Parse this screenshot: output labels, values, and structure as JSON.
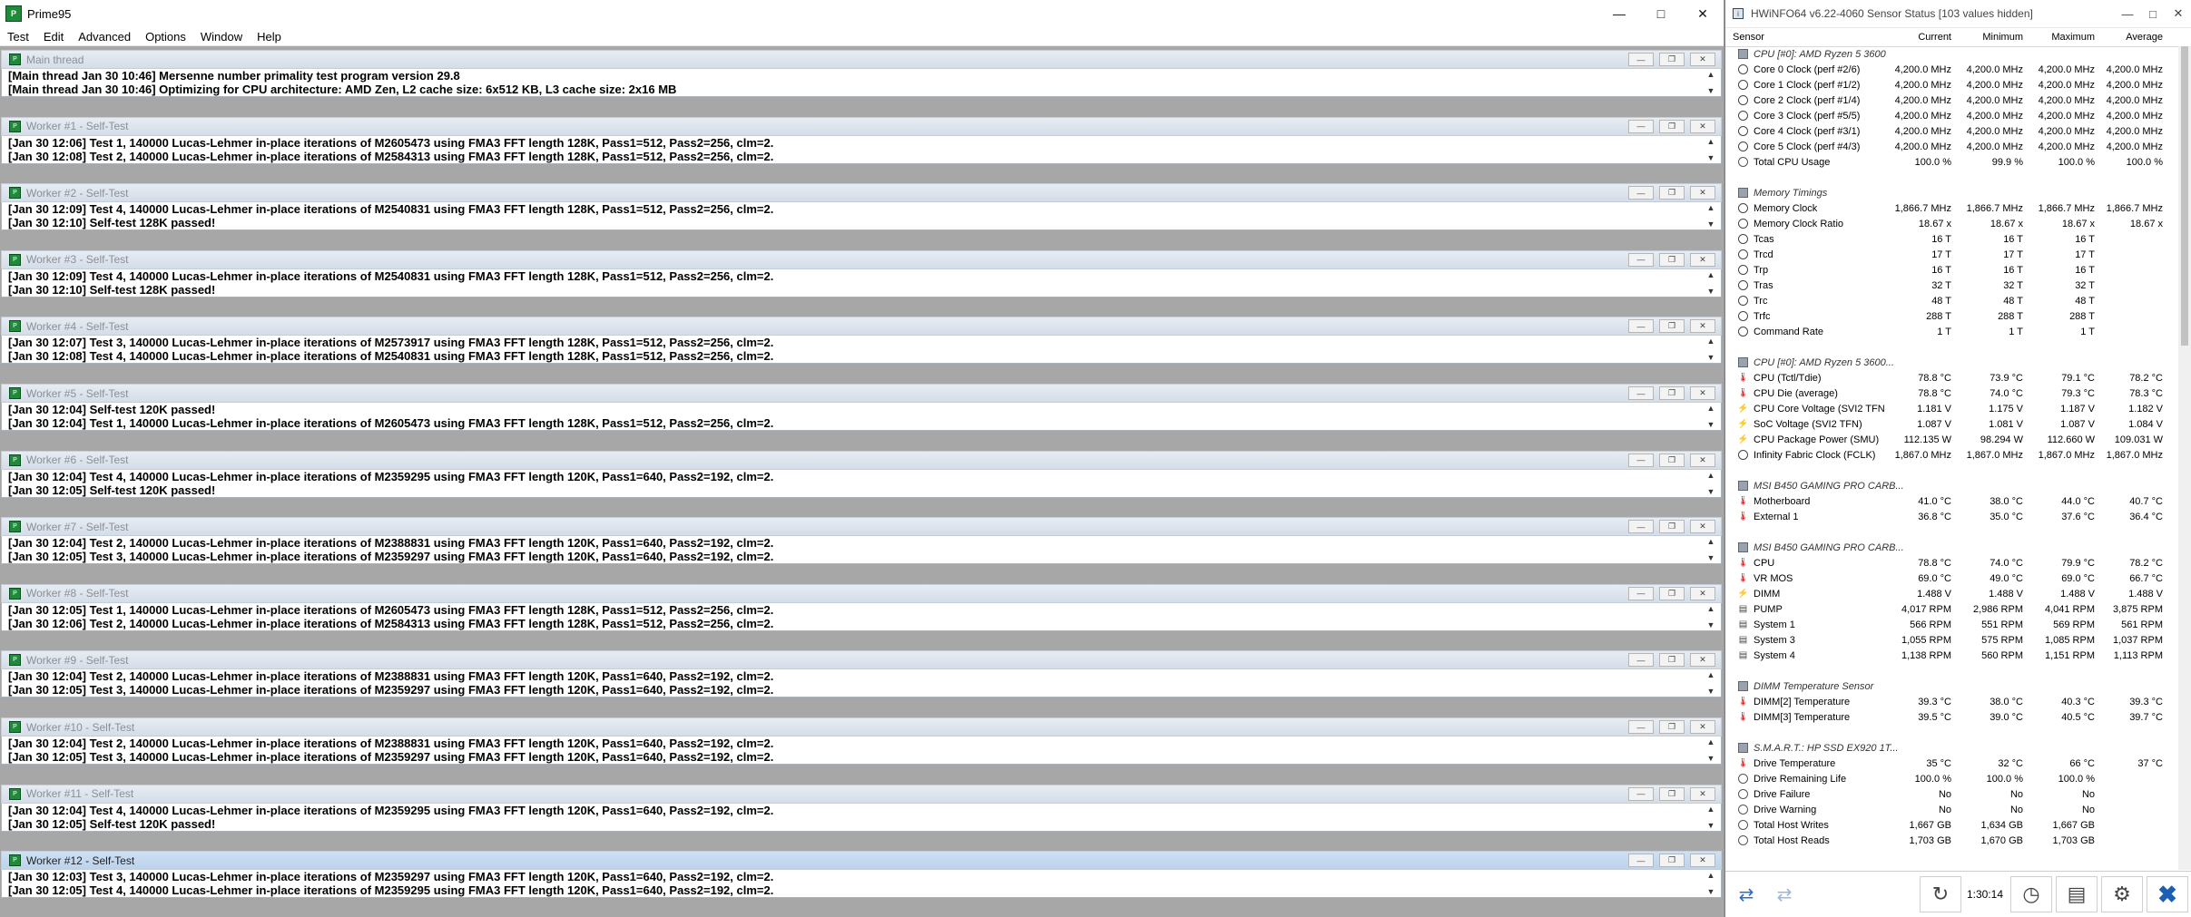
{
  "prime95": {
    "title": "Prime95",
    "menu": [
      "Test",
      "Edit",
      "Advanced",
      "Options",
      "Window",
      "Help"
    ],
    "windows": [
      {
        "title": "Main thread",
        "lines": [
          "[Main thread Jan 30 10:46] Mersenne number primality test program version 29.8",
          "[Main thread Jan 30 10:46] Optimizing for CPU architecture: AMD Zen, L2 cache size: 6x512 KB, L3 cache size: 2x16 MB"
        ]
      },
      {
        "title": "Worker #1 - Self-Test",
        "lines": [
          "[Jan 30 12:06] Test 1, 140000 Lucas-Lehmer in-place iterations of M2605473 using FMA3 FFT length 128K, Pass1=512, Pass2=256, clm=2.",
          "[Jan 30 12:08] Test 2, 140000 Lucas-Lehmer in-place iterations of M2584313 using FMA3 FFT length 128K, Pass1=512, Pass2=256, clm=2."
        ]
      },
      {
        "title": "Worker #2 - Self-Test",
        "lines": [
          "[Jan 30 12:09] Test 4, 140000 Lucas-Lehmer in-place iterations of M2540831 using FMA3 FFT length 128K, Pass1=512, Pass2=256, clm=2.",
          "[Jan 30 12:10] Self-test 128K passed!"
        ]
      },
      {
        "title": "Worker #3 - Self-Test",
        "lines": [
          "[Jan 30 12:09] Test 4, 140000 Lucas-Lehmer in-place iterations of M2540831 using FMA3 FFT length 128K, Pass1=512, Pass2=256, clm=2.",
          "[Jan 30 12:10] Self-test 128K passed!"
        ]
      },
      {
        "title": "Worker #4 - Self-Test",
        "lines": [
          "[Jan 30 12:07] Test 3, 140000 Lucas-Lehmer in-place iterations of M2573917 using FMA3 FFT length 128K, Pass1=512, Pass2=256, clm=2.",
          "[Jan 30 12:08] Test 4, 140000 Lucas-Lehmer in-place iterations of M2540831 using FMA3 FFT length 128K, Pass1=512, Pass2=256, clm=2."
        ]
      },
      {
        "title": "Worker #5 - Self-Test",
        "lines": [
          "[Jan 30 12:04] Self-test 120K passed!",
          "[Jan 30 12:04] Test 1, 140000 Lucas-Lehmer in-place iterations of M2605473 using FMA3 FFT length 128K, Pass1=512, Pass2=256, clm=2."
        ]
      },
      {
        "title": "Worker #6 - Self-Test",
        "lines": [
          "[Jan 30 12:04] Test 4, 140000 Lucas-Lehmer in-place iterations of M2359295 using FMA3 FFT length 120K, Pass1=640, Pass2=192, clm=2.",
          "[Jan 30 12:05] Self-test 120K passed!"
        ]
      },
      {
        "title": "Worker #7 - Self-Test",
        "lines": [
          "[Jan 30 12:04] Test 2, 140000 Lucas-Lehmer in-place iterations of M2388831 using FMA3 FFT length 120K, Pass1=640, Pass2=192, clm=2.",
          "[Jan 30 12:05] Test 3, 140000 Lucas-Lehmer in-place iterations of M2359297 using FMA3 FFT length 120K, Pass1=640, Pass2=192, clm=2."
        ]
      },
      {
        "title": "Worker #8 - Self-Test",
        "lines": [
          "[Jan 30 12:05] Test 1, 140000 Lucas-Lehmer in-place iterations of M2605473 using FMA3 FFT length 128K, Pass1=512, Pass2=256, clm=2.",
          "[Jan 30 12:06] Test 2, 140000 Lucas-Lehmer in-place iterations of M2584313 using FMA3 FFT length 128K, Pass1=512, Pass2=256, clm=2."
        ]
      },
      {
        "title": "Worker #9 - Self-Test",
        "lines": [
          "[Jan 30 12:04] Test 2, 140000 Lucas-Lehmer in-place iterations of M2388831 using FMA3 FFT length 120K, Pass1=640, Pass2=192, clm=2.",
          "[Jan 30 12:05] Test 3, 140000 Lucas-Lehmer in-place iterations of M2359297 using FMA3 FFT length 120K, Pass1=640, Pass2=192, clm=2."
        ]
      },
      {
        "title": "Worker #10 - Self-Test",
        "lines": [
          "[Jan 30 12:04] Test 2, 140000 Lucas-Lehmer in-place iterations of M2388831 using FMA3 FFT length 120K, Pass1=640, Pass2=192, clm=2.",
          "[Jan 30 12:05] Test 3, 140000 Lucas-Lehmer in-place iterations of M2359297 using FMA3 FFT length 120K, Pass1=640, Pass2=192, clm=2."
        ]
      },
      {
        "title": "Worker #11 - Self-Test",
        "lines": [
          "[Jan 30 12:04] Test 4, 140000 Lucas-Lehmer in-place iterations of M2359295 using FMA3 FFT length 120K, Pass1=640, Pass2=192, clm=2.",
          "[Jan 30 12:05] Self-test 120K passed!"
        ]
      },
      {
        "title": "Worker #12 - Self-Test",
        "lines": [
          "[Jan 30 12:03] Test 3, 140000 Lucas-Lehmer in-place iterations of M2359297 using FMA3 FFT length 120K, Pass1=640, Pass2=192, clm=2.",
          "[Jan 30 12:05] Test 4, 140000 Lucas-Lehmer in-place iterations of M2359295 using FMA3 FFT length 120K, Pass1=640, Pass2=192, clm=2."
        ],
        "active": true
      }
    ]
  },
  "hwinfo": {
    "title": "HWiNFO64 v6.22-4060 Sensor Status [103 values hidden]",
    "columns": [
      "Sensor",
      "Current",
      "Minimum",
      "Maximum",
      "Average"
    ],
    "rows": [
      {
        "type": "group",
        "label": "CPU [#0]: AMD Ryzen 5 3600"
      },
      {
        "icon": "clock",
        "label": "Core 0 Clock (perf #2/6)",
        "v": [
          "4,200.0 MHz",
          "4,200.0 MHz",
          "4,200.0 MHz",
          "4,200.0 MHz"
        ]
      },
      {
        "icon": "clock",
        "label": "Core 1 Clock (perf #1/2)",
        "v": [
          "4,200.0 MHz",
          "4,200.0 MHz",
          "4,200.0 MHz",
          "4,200.0 MHz"
        ]
      },
      {
        "icon": "clock",
        "label": "Core 2 Clock (perf #1/4)",
        "v": [
          "4,200.0 MHz",
          "4,200.0 MHz",
          "4,200.0 MHz",
          "4,200.0 MHz"
        ]
      },
      {
        "icon": "clock",
        "label": "Core 3 Clock (perf #5/5)",
        "v": [
          "4,200.0 MHz",
          "4,200.0 MHz",
          "4,200.0 MHz",
          "4,200.0 MHz"
        ]
      },
      {
        "icon": "clock",
        "label": "Core 4 Clock (perf #3/1)",
        "v": [
          "4,200.0 MHz",
          "4,200.0 MHz",
          "4,200.0 MHz",
          "4,200.0 MHz"
        ]
      },
      {
        "icon": "clock",
        "label": "Core 5 Clock (perf #4/3)",
        "v": [
          "4,200.0 MHz",
          "4,200.0 MHz",
          "4,200.0 MHz",
          "4,200.0 MHz"
        ]
      },
      {
        "icon": "gen",
        "label": "Total CPU Usage",
        "v": [
          "100.0 %",
          "99.9 %",
          "100.0 %",
          "100.0 %"
        ]
      },
      {
        "type": "spacer"
      },
      {
        "type": "group",
        "label": "Memory Timings"
      },
      {
        "icon": "clock",
        "label": "Memory Clock",
        "v": [
          "1,866.7 MHz",
          "1,866.7 MHz",
          "1,866.7 MHz",
          "1,866.7 MHz"
        ]
      },
      {
        "icon": "clock",
        "label": "Memory Clock Ratio",
        "v": [
          "18.67 x",
          "18.67 x",
          "18.67 x",
          "18.67 x"
        ]
      },
      {
        "icon": "clock",
        "label": "Tcas",
        "v": [
          "16 T",
          "16 T",
          "16 T",
          ""
        ]
      },
      {
        "icon": "clock",
        "label": "Trcd",
        "v": [
          "17 T",
          "17 T",
          "17 T",
          ""
        ]
      },
      {
        "icon": "clock",
        "label": "Trp",
        "v": [
          "16 T",
          "16 T",
          "16 T",
          ""
        ]
      },
      {
        "icon": "clock",
        "label": "Tras",
        "v": [
          "32 T",
          "32 T",
          "32 T",
          ""
        ]
      },
      {
        "icon": "clock",
        "label": "Trc",
        "v": [
          "48 T",
          "48 T",
          "48 T",
          ""
        ]
      },
      {
        "icon": "clock",
        "label": "Trfc",
        "v": [
          "288 T",
          "288 T",
          "288 T",
          ""
        ]
      },
      {
        "icon": "clock",
        "label": "Command Rate",
        "v": [
          "1 T",
          "1 T",
          "1 T",
          ""
        ]
      },
      {
        "type": "spacer"
      },
      {
        "type": "group",
        "label": "CPU [#0]: AMD Ryzen 5 3600..."
      },
      {
        "icon": "therm",
        "label": "CPU (Tctl/Tdie)",
        "v": [
          "78.8 °C",
          "73.9 °C",
          "79.1 °C",
          "78.2 °C"
        ]
      },
      {
        "icon": "therm",
        "label": "CPU Die (average)",
        "v": [
          "78.8 °C",
          "74.0 °C",
          "79.3 °C",
          "78.3 °C"
        ]
      },
      {
        "icon": "bolt",
        "label": "CPU Core Voltage (SVI2 TFN)",
        "v": [
          "1.181 V",
          "1.175 V",
          "1.187 V",
          "1.182 V"
        ]
      },
      {
        "icon": "bolt",
        "label": "SoC Voltage (SVI2 TFN)",
        "v": [
          "1.087 V",
          "1.081 V",
          "1.087 V",
          "1.084 V"
        ]
      },
      {
        "icon": "bolt",
        "label": "CPU Package Power (SMU)",
        "v": [
          "112.135 W",
          "98.294 W",
          "112.660 W",
          "109.031 W"
        ]
      },
      {
        "icon": "clock",
        "label": "Infinity Fabric Clock (FCLK)",
        "v": [
          "1,867.0 MHz",
          "1,867.0 MHz",
          "1,867.0 MHz",
          "1,867.0 MHz"
        ]
      },
      {
        "type": "spacer"
      },
      {
        "type": "group",
        "label": "MSI B450 GAMING PRO CARB..."
      },
      {
        "icon": "therm",
        "label": "Motherboard",
        "v": [
          "41.0 °C",
          "38.0 °C",
          "44.0 °C",
          "40.7 °C"
        ]
      },
      {
        "icon": "therm",
        "label": "External 1",
        "v": [
          "36.8 °C",
          "35.0 °C",
          "37.6 °C",
          "36.4 °C"
        ]
      },
      {
        "type": "spacer"
      },
      {
        "type": "group",
        "label": "MSI B450 GAMING PRO CARB..."
      },
      {
        "icon": "therm",
        "label": "CPU",
        "v": [
          "78.8 °C",
          "74.0 °C",
          "79.9 °C",
          "78.2 °C"
        ]
      },
      {
        "icon": "therm",
        "label": "VR MOS",
        "v": [
          "69.0 °C",
          "49.0 °C",
          "69.0 °C",
          "66.7 °C"
        ]
      },
      {
        "icon": "bolt",
        "label": "DIMM",
        "v": [
          "1.488 V",
          "1.488 V",
          "1.488 V",
          "1.488 V"
        ]
      },
      {
        "icon": "fan",
        "label": "PUMP",
        "v": [
          "4,017 RPM",
          "2,986 RPM",
          "4,041 RPM",
          "3,875 RPM"
        ]
      },
      {
        "icon": "fan",
        "label": "System 1",
        "v": [
          "566 RPM",
          "551 RPM",
          "569 RPM",
          "561 RPM"
        ]
      },
      {
        "icon": "fan",
        "label": "System 3",
        "v": [
          "1,055 RPM",
          "575 RPM",
          "1,085 RPM",
          "1,037 RPM"
        ]
      },
      {
        "icon": "fan",
        "label": "System 4",
        "v": [
          "1,138 RPM",
          "560 RPM",
          "1,151 RPM",
          "1,113 RPM"
        ]
      },
      {
        "type": "spacer"
      },
      {
        "type": "group",
        "label": "DIMM Temperature Sensor"
      },
      {
        "icon": "therm",
        "label": "DIMM[2] Temperature",
        "v": [
          "39.3 °C",
          "38.0 °C",
          "40.3 °C",
          "39.3 °C"
        ]
      },
      {
        "icon": "therm",
        "label": "DIMM[3] Temperature",
        "v": [
          "39.5 °C",
          "39.0 °C",
          "40.5 °C",
          "39.7 °C"
        ]
      },
      {
        "type": "spacer"
      },
      {
        "type": "group",
        "label": "S.M.A.R.T.: HP SSD EX920 1T..."
      },
      {
        "icon": "therm",
        "label": "Drive Temperature",
        "v": [
          "35 °C",
          "32 °C",
          "66 °C",
          "37 °C"
        ]
      },
      {
        "icon": "gen",
        "label": "Drive Remaining Life",
        "v": [
          "100.0 %",
          "100.0 %",
          "100.0 %",
          ""
        ]
      },
      {
        "icon": "gen",
        "label": "Drive Failure",
        "v": [
          "No",
          "No",
          "No",
          ""
        ]
      },
      {
        "icon": "gen",
        "label": "Drive Warning",
        "v": [
          "No",
          "No",
          "No",
          ""
        ]
      },
      {
        "icon": "gen",
        "label": "Total Host Writes",
        "v": [
          "1,667 GB",
          "1,634 GB",
          "1,667 GB",
          ""
        ]
      },
      {
        "icon": "gen",
        "label": "Total Host Reads",
        "v": [
          "1,703 GB",
          "1,670 GB",
          "1,703 GB",
          ""
        ]
      }
    ],
    "footer": {
      "time": "1:30:14"
    }
  }
}
